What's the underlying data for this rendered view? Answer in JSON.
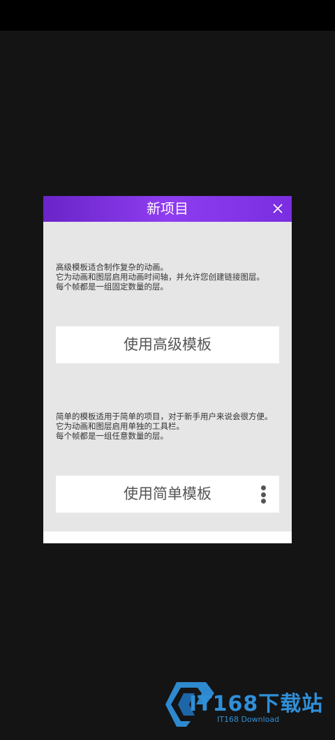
{
  "dialog": {
    "title": "新项目",
    "advanced": {
      "description_lines": [
        "高级模板适合制作复杂的动画。",
        "它为动画和图层启用动画时间轴，并允许您创建链接图层。",
        "每个帧都是一组固定数量的层。"
      ],
      "button_label": "使用高级模板"
    },
    "simple": {
      "description_lines": [
        "简单的模板适用于简单的项目，对于新手用户来说会很方便。",
        "它为动画和图层启用单独的工具栏。",
        "每个帧都是一组任意数量的层。"
      ],
      "button_label": "使用简单模板"
    }
  },
  "icons": {
    "close": "close-icon",
    "more": "more-vertical-icon"
  },
  "watermark": {
    "main_text": "IT168下载站",
    "sub_text": "IT168 Download"
  },
  "colors": {
    "header_gradient_start": "#6a24c8",
    "header_gradient_end": "#8e3df0",
    "dialog_background": "#e6e6e6",
    "page_background": "#141414",
    "watermark": "#2f8fd8"
  }
}
